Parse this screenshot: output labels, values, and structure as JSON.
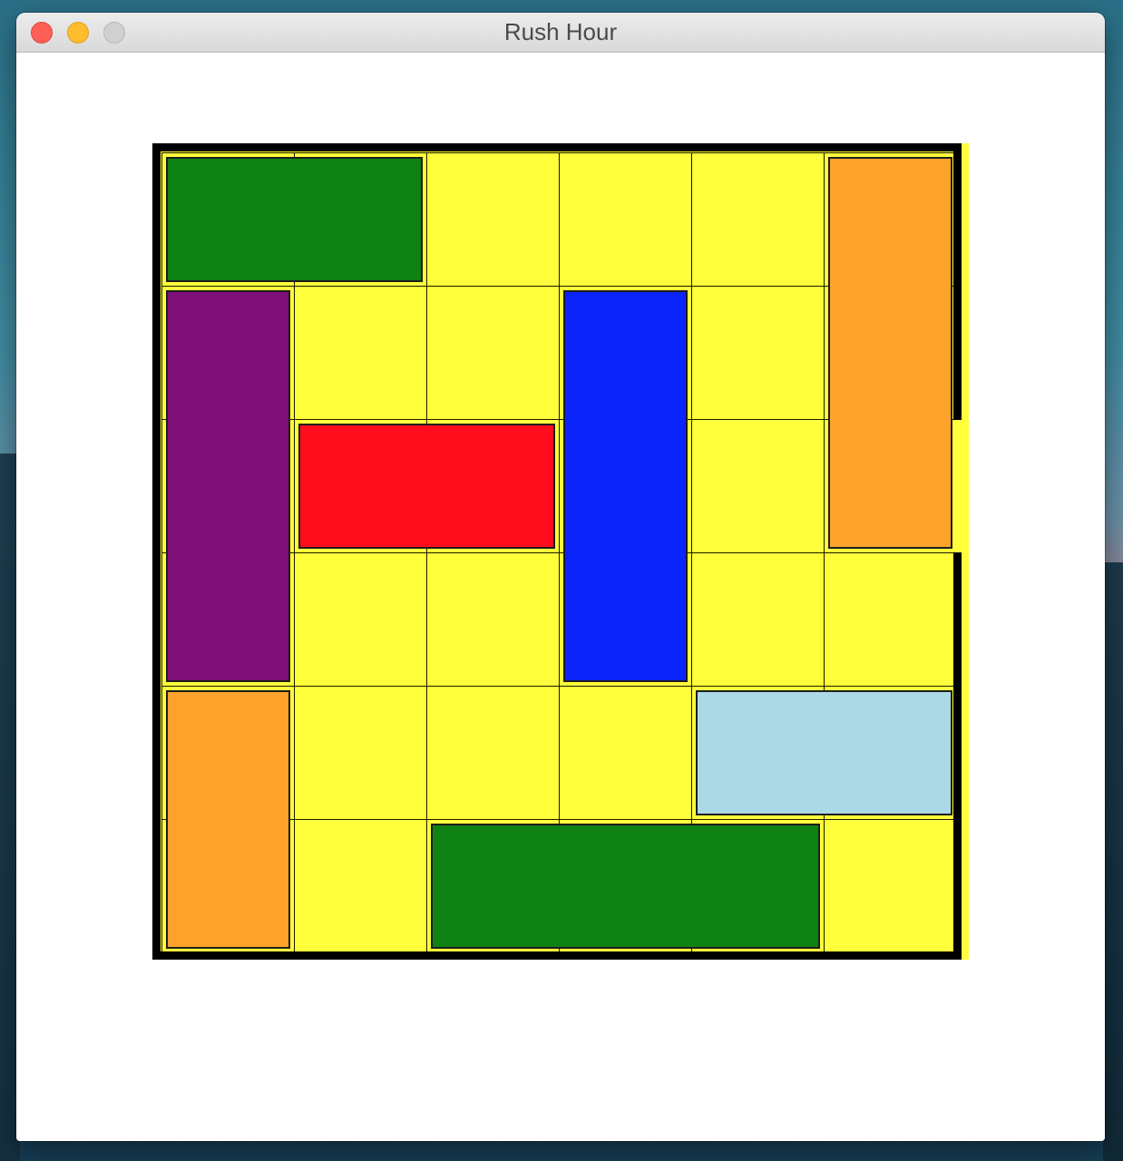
{
  "window": {
    "title": "Rush Hour"
  },
  "board": {
    "rows": 6,
    "cols": 6,
    "background_color": "#ffff3b",
    "grid_line_color": "#000000",
    "exit": {
      "side": "right",
      "row": 2
    }
  },
  "vehicles": [
    {
      "id": "green-car-top",
      "color": "#0e8212",
      "row": 0,
      "col": 0,
      "length": 2,
      "orientation": "horizontal"
    },
    {
      "id": "orange-truck-right",
      "color": "#fea32a",
      "row": 0,
      "col": 5,
      "length": 3,
      "orientation": "vertical"
    },
    {
      "id": "purple-truck",
      "color": "#7f0f78",
      "row": 1,
      "col": 0,
      "length": 3,
      "orientation": "vertical"
    },
    {
      "id": "blue-truck",
      "color": "#0b24fa",
      "row": 1,
      "col": 3,
      "length": 3,
      "orientation": "vertical"
    },
    {
      "id": "red-target-car",
      "color": "#fe0d1d",
      "row": 2,
      "col": 1,
      "length": 2,
      "orientation": "horizontal"
    },
    {
      "id": "orange-car-bottom-left",
      "color": "#fea32a",
      "row": 4,
      "col": 0,
      "length": 2,
      "orientation": "vertical"
    },
    {
      "id": "light-blue-car",
      "color": "#add8e6",
      "row": 4,
      "col": 4,
      "length": 2,
      "orientation": "horizontal"
    },
    {
      "id": "green-truck-bottom",
      "color": "#0e8212",
      "row": 5,
      "col": 2,
      "length": 3,
      "orientation": "horizontal"
    }
  ]
}
